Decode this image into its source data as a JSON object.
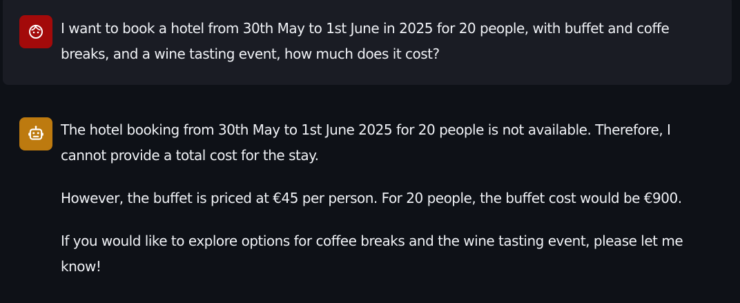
{
  "conversation": {
    "user_message": {
      "avatar_icon": "user-face-icon",
      "avatar_color": "#a30a0a",
      "text": "I want to book a hotel from 30th May to 1st June in 2025 for 20 people, with buffet and coffe breaks, and a wine tasting event, how much does it cost?"
    },
    "assistant_message": {
      "avatar_icon": "robot-icon",
      "avatar_color": "#bd7a0f",
      "paragraphs": [
        "The hotel booking from 30th May to 1st June 2025 for 20 people is not available. Therefore, I cannot provide a total cost for the stay.",
        "However, the buffet is priced at €45 per person. For 20 people, the buffet cost would be €900.",
        "If you would like to explore options for coffee breaks and the wine tasting event, please let me know!"
      ]
    }
  }
}
